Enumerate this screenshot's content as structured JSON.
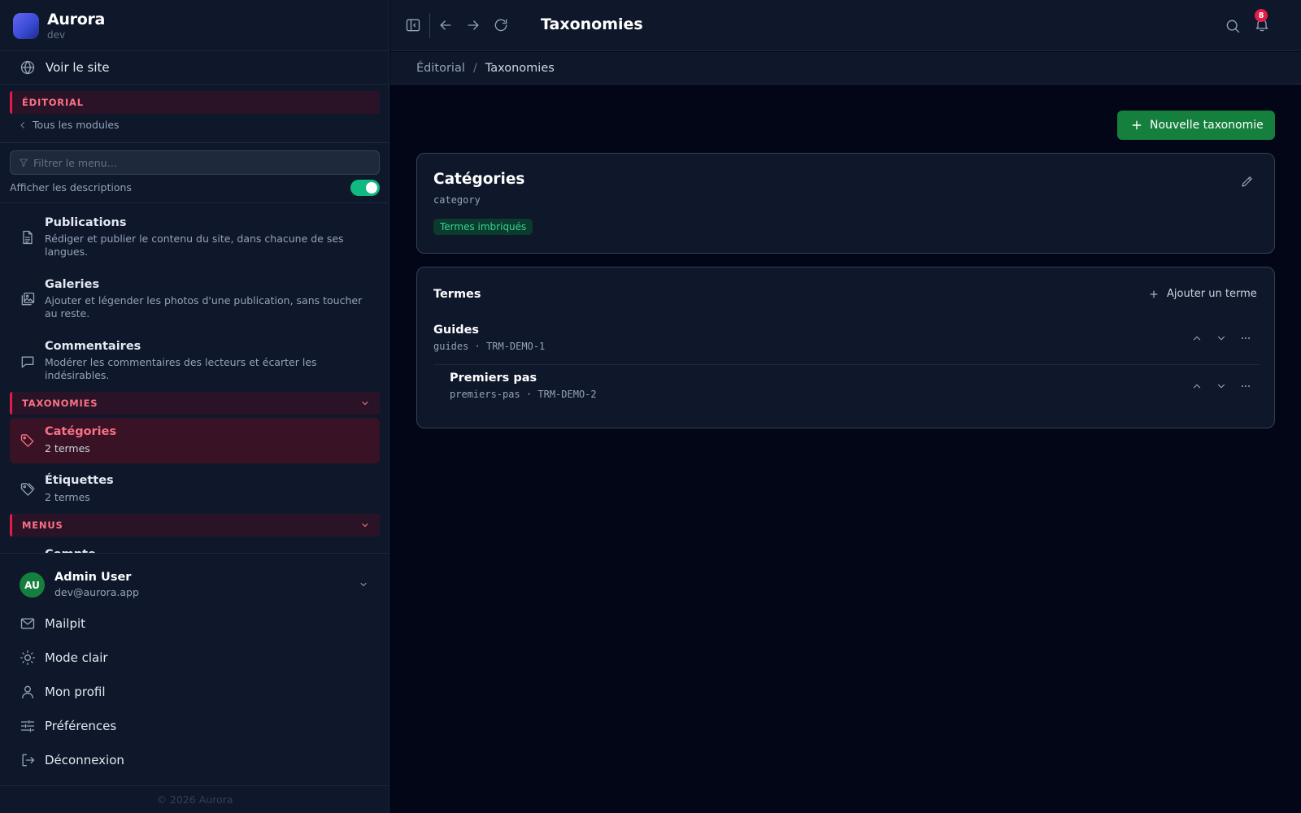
{
  "brand": {
    "name": "Aurora",
    "env": "dev"
  },
  "sidebar": {
    "view_site": "Voir le site",
    "editorial_header": "ÉDITORIAL",
    "all_modules": "Tous les modules",
    "filter_placeholder": "Filtrer le menu…",
    "descriptions_label": "Afficher les descriptions",
    "descriptions_on": true,
    "items": [
      {
        "title": "Publications",
        "desc": "Rédiger et publier le contenu du site, dans chacune de ses langues.",
        "icon": "document-icon"
      },
      {
        "title": "Galeries",
        "desc": "Ajouter et légender les photos d'une publication, sans toucher au reste.",
        "icon": "gallery-icon"
      },
      {
        "title": "Commentaires",
        "desc": "Modérer les commentaires des lecteurs et écarter les indésirables.",
        "icon": "comment-icon"
      }
    ],
    "taxonomies_header": "TAXONOMIES",
    "tax_items": [
      {
        "title": "Catégories",
        "desc": "2 termes",
        "active": true
      },
      {
        "title": "Étiquettes",
        "desc": "2 termes",
        "active": false
      }
    ],
    "menus_header": "MENUS",
    "partial_item": "Compte",
    "user": {
      "initials": "AU",
      "name": "Admin User",
      "email": "dev@aurora.app"
    },
    "footer_items": [
      {
        "label": "Mailpit",
        "icon": "mail-icon"
      },
      {
        "label": "Mode clair",
        "icon": "sun-icon"
      },
      {
        "label": "Mon profil",
        "icon": "user-icon"
      },
      {
        "label": "Préférences",
        "icon": "sliders-icon"
      },
      {
        "label": "Déconnexion",
        "icon": "logout-icon"
      }
    ],
    "copyright": "© 2026 Aurora"
  },
  "topbar": {
    "title": "Taxonomies",
    "notifications": "8"
  },
  "breadcrumb": {
    "parent": "Éditorial",
    "separator": "/",
    "current": "Taxonomies"
  },
  "main": {
    "new_button": "Nouvelle taxonomie",
    "taxonomy": {
      "title": "Catégories",
      "slug": "category",
      "badge": "Termes imbriqués"
    },
    "terms": {
      "title": "Termes",
      "add_label": "Ajouter un terme",
      "rows": [
        {
          "name": "Guides",
          "meta": "guides · TRM-DEMO-1",
          "level": 0
        },
        {
          "name": "Premiers pas",
          "meta": "premiers-pas · TRM-DEMO-2",
          "level": 1
        }
      ]
    }
  },
  "colors": {
    "accent": "#e11d48",
    "accent_text": "#fb7185",
    "success": "#15803d",
    "toggle": "#10b981"
  }
}
